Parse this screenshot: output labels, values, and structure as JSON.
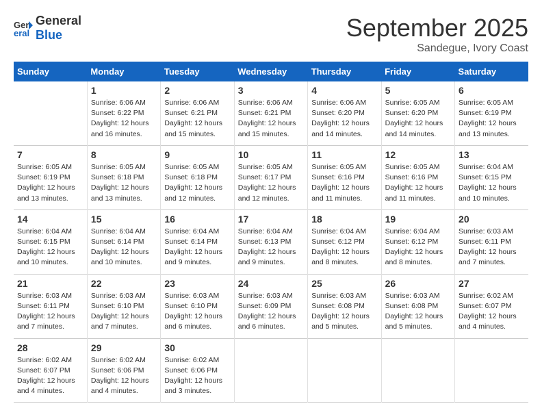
{
  "header": {
    "logo_general": "General",
    "logo_blue": "Blue",
    "month_title": "September 2025",
    "location": "Sandegue, Ivory Coast"
  },
  "weekdays": [
    "Sunday",
    "Monday",
    "Tuesday",
    "Wednesday",
    "Thursday",
    "Friday",
    "Saturday"
  ],
  "weeks": [
    [
      {
        "day": "",
        "sunrise": "",
        "sunset": "",
        "daylight": ""
      },
      {
        "day": "1",
        "sunrise": "Sunrise: 6:06 AM",
        "sunset": "Sunset: 6:22 PM",
        "daylight": "Daylight: 12 hours and 16 minutes."
      },
      {
        "day": "2",
        "sunrise": "Sunrise: 6:06 AM",
        "sunset": "Sunset: 6:21 PM",
        "daylight": "Daylight: 12 hours and 15 minutes."
      },
      {
        "day": "3",
        "sunrise": "Sunrise: 6:06 AM",
        "sunset": "Sunset: 6:21 PM",
        "daylight": "Daylight: 12 hours and 15 minutes."
      },
      {
        "day": "4",
        "sunrise": "Sunrise: 6:06 AM",
        "sunset": "Sunset: 6:20 PM",
        "daylight": "Daylight: 12 hours and 14 minutes."
      },
      {
        "day": "5",
        "sunrise": "Sunrise: 6:05 AM",
        "sunset": "Sunset: 6:20 PM",
        "daylight": "Daylight: 12 hours and 14 minutes."
      },
      {
        "day": "6",
        "sunrise": "Sunrise: 6:05 AM",
        "sunset": "Sunset: 6:19 PM",
        "daylight": "Daylight: 12 hours and 13 minutes."
      }
    ],
    [
      {
        "day": "7",
        "sunrise": "Sunrise: 6:05 AM",
        "sunset": "Sunset: 6:19 PM",
        "daylight": "Daylight: 12 hours and 13 minutes."
      },
      {
        "day": "8",
        "sunrise": "Sunrise: 6:05 AM",
        "sunset": "Sunset: 6:18 PM",
        "daylight": "Daylight: 12 hours and 13 minutes."
      },
      {
        "day": "9",
        "sunrise": "Sunrise: 6:05 AM",
        "sunset": "Sunset: 6:18 PM",
        "daylight": "Daylight: 12 hours and 12 minutes."
      },
      {
        "day": "10",
        "sunrise": "Sunrise: 6:05 AM",
        "sunset": "Sunset: 6:17 PM",
        "daylight": "Daylight: 12 hours and 12 minutes."
      },
      {
        "day": "11",
        "sunrise": "Sunrise: 6:05 AM",
        "sunset": "Sunset: 6:16 PM",
        "daylight": "Daylight: 12 hours and 11 minutes."
      },
      {
        "day": "12",
        "sunrise": "Sunrise: 6:05 AM",
        "sunset": "Sunset: 6:16 PM",
        "daylight": "Daylight: 12 hours and 11 minutes."
      },
      {
        "day": "13",
        "sunrise": "Sunrise: 6:04 AM",
        "sunset": "Sunset: 6:15 PM",
        "daylight": "Daylight: 12 hours and 10 minutes."
      }
    ],
    [
      {
        "day": "14",
        "sunrise": "Sunrise: 6:04 AM",
        "sunset": "Sunset: 6:15 PM",
        "daylight": "Daylight: 12 hours and 10 minutes."
      },
      {
        "day": "15",
        "sunrise": "Sunrise: 6:04 AM",
        "sunset": "Sunset: 6:14 PM",
        "daylight": "Daylight: 12 hours and 10 minutes."
      },
      {
        "day": "16",
        "sunrise": "Sunrise: 6:04 AM",
        "sunset": "Sunset: 6:14 PM",
        "daylight": "Daylight: 12 hours and 9 minutes."
      },
      {
        "day": "17",
        "sunrise": "Sunrise: 6:04 AM",
        "sunset": "Sunset: 6:13 PM",
        "daylight": "Daylight: 12 hours and 9 minutes."
      },
      {
        "day": "18",
        "sunrise": "Sunrise: 6:04 AM",
        "sunset": "Sunset: 6:12 PM",
        "daylight": "Daylight: 12 hours and 8 minutes."
      },
      {
        "day": "19",
        "sunrise": "Sunrise: 6:04 AM",
        "sunset": "Sunset: 6:12 PM",
        "daylight": "Daylight: 12 hours and 8 minutes."
      },
      {
        "day": "20",
        "sunrise": "Sunrise: 6:03 AM",
        "sunset": "Sunset: 6:11 PM",
        "daylight": "Daylight: 12 hours and 7 minutes."
      }
    ],
    [
      {
        "day": "21",
        "sunrise": "Sunrise: 6:03 AM",
        "sunset": "Sunset: 6:11 PM",
        "daylight": "Daylight: 12 hours and 7 minutes."
      },
      {
        "day": "22",
        "sunrise": "Sunrise: 6:03 AM",
        "sunset": "Sunset: 6:10 PM",
        "daylight": "Daylight: 12 hours and 7 minutes."
      },
      {
        "day": "23",
        "sunrise": "Sunrise: 6:03 AM",
        "sunset": "Sunset: 6:10 PM",
        "daylight": "Daylight: 12 hours and 6 minutes."
      },
      {
        "day": "24",
        "sunrise": "Sunrise: 6:03 AM",
        "sunset": "Sunset: 6:09 PM",
        "daylight": "Daylight: 12 hours and 6 minutes."
      },
      {
        "day": "25",
        "sunrise": "Sunrise: 6:03 AM",
        "sunset": "Sunset: 6:08 PM",
        "daylight": "Daylight: 12 hours and 5 minutes."
      },
      {
        "day": "26",
        "sunrise": "Sunrise: 6:03 AM",
        "sunset": "Sunset: 6:08 PM",
        "daylight": "Daylight: 12 hours and 5 minutes."
      },
      {
        "day": "27",
        "sunrise": "Sunrise: 6:02 AM",
        "sunset": "Sunset: 6:07 PM",
        "daylight": "Daylight: 12 hours and 4 minutes."
      }
    ],
    [
      {
        "day": "28",
        "sunrise": "Sunrise: 6:02 AM",
        "sunset": "Sunset: 6:07 PM",
        "daylight": "Daylight: 12 hours and 4 minutes."
      },
      {
        "day": "29",
        "sunrise": "Sunrise: 6:02 AM",
        "sunset": "Sunset: 6:06 PM",
        "daylight": "Daylight: 12 hours and 4 minutes."
      },
      {
        "day": "30",
        "sunrise": "Sunrise: 6:02 AM",
        "sunset": "Sunset: 6:06 PM",
        "daylight": "Daylight: 12 hours and 3 minutes."
      },
      {
        "day": "",
        "sunrise": "",
        "sunset": "",
        "daylight": ""
      },
      {
        "day": "",
        "sunrise": "",
        "sunset": "",
        "daylight": ""
      },
      {
        "day": "",
        "sunrise": "",
        "sunset": "",
        "daylight": ""
      },
      {
        "day": "",
        "sunrise": "",
        "sunset": "",
        "daylight": ""
      }
    ]
  ]
}
